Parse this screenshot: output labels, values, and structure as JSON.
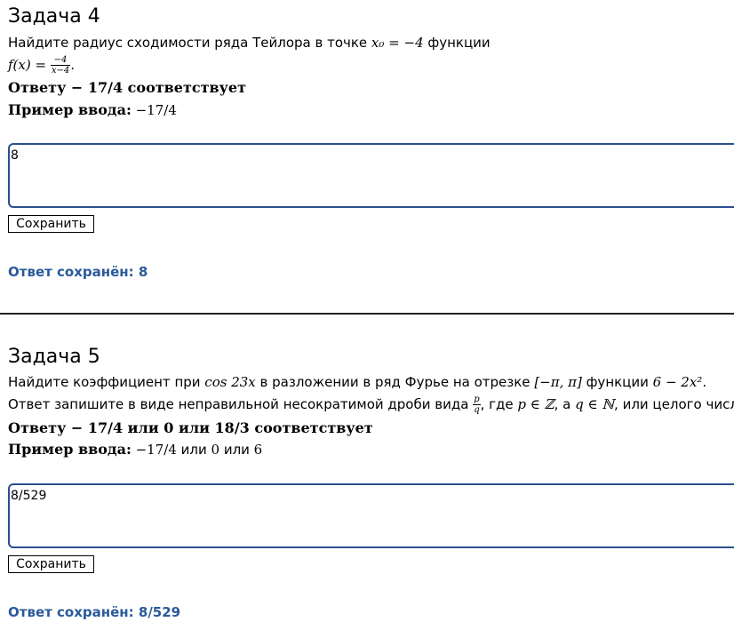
{
  "task4": {
    "title": "Задача 4",
    "q_pre": "Найдите радиус сходимости ряда Тейлора в точке ",
    "q_point": "x₀ = −4",
    "q_post": " функции",
    "func_lhs": "f(x) = ",
    "func_num": "−4",
    "func_den": "x−4",
    "func_end": ".",
    "hint_label": "Ответу ",
    "hint_value": "− 17/4",
    "hint_tail": " соответствует",
    "example_label": "Пример ввода:",
    "example_value": " −17/4",
    "answer_value": "8",
    "save_label": "Сохранить",
    "saved_text": "Ответ сохранён: 8"
  },
  "task5": {
    "title": "Задача 5",
    "q_pre": "Найдите коэффициент при ",
    "q_cos": "cos 23x",
    "q_mid": " в разложении в ряд Фурье на отрезке ",
    "q_interval": "[−π, π]",
    "q_func_word": " функции ",
    "q_func": "6 − 2x²",
    "q_end": ".",
    "fmt_pre": "Ответ запишите в виде неправильной несократимой дроби вида ",
    "fmt_num": "p",
    "fmt_den": "q",
    "fmt_mid": ", где ",
    "fmt_p": "p ∈ ℤ",
    "fmt_a": ", а ",
    "fmt_q": "q ∈ ℕ",
    "fmt_post": ", или целого числа.",
    "hint_label": "Ответу ",
    "hint_value": "− 17/4",
    "hint_or1": " или ",
    "hint_value2": "0",
    "hint_or2": " или ",
    "hint_value3": "18/3",
    "hint_tail": " соответствует",
    "example_label": "Пример ввода:",
    "example_v1": " −17/4",
    "example_or1": " или ",
    "example_v2": "0",
    "example_or2": " или ",
    "example_v3": "6",
    "answer_value": "8/529",
    "save_label": "Сохранить",
    "saved_text": "Ответ сохранён: 8/529"
  },
  "colors": {
    "accent": "#2a4f8f",
    "saved_text": "#2a5a9a",
    "divider": "#222222"
  }
}
